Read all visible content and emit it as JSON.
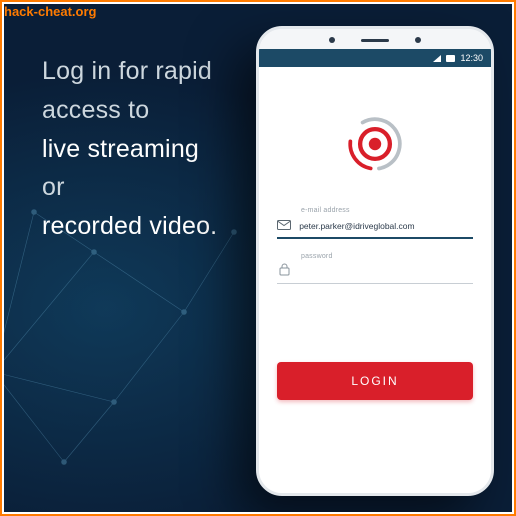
{
  "watermark": "hack-cheat.org",
  "promo": {
    "line1": "Log in for rapid",
    "line2": "access to",
    "line3_bold": "live streaming",
    "line4": "or",
    "line5_bold": "recorded video."
  },
  "status_bar": {
    "time": "12:30"
  },
  "form": {
    "email_label": "e-mail address",
    "email_value": "peter.parker@idriveglobal.com",
    "password_label": "password",
    "password_value": ""
  },
  "login_button_label": "LOGIN",
  "colors": {
    "accent_red": "#d91f2a",
    "frame_orange": "#ff7b00",
    "status_blue": "#1c4a66"
  }
}
